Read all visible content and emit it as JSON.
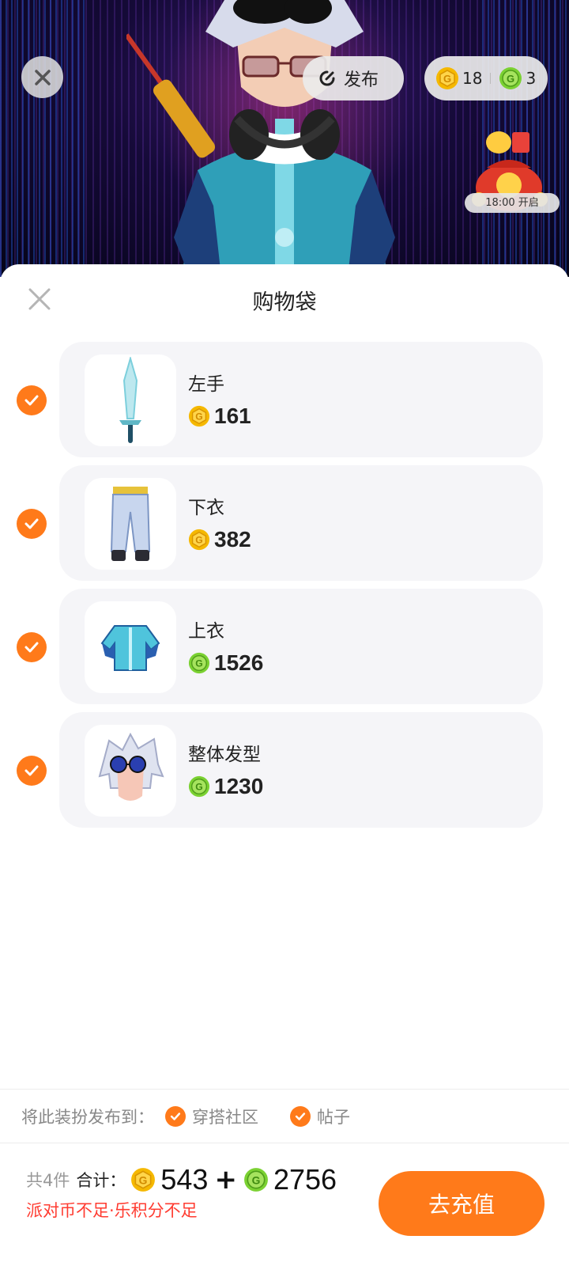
{
  "header": {
    "publish_label": "发布",
    "coins": {
      "gold": "18",
      "green": "3"
    },
    "gift_time": "18:00 开启"
  },
  "sheet": {
    "title": "购物袋",
    "items": [
      {
        "name": "左手",
        "currency": "gold",
        "price": "161",
        "icon": "sword-icon"
      },
      {
        "name": "下衣",
        "currency": "gold",
        "price": "382",
        "icon": "pants-icon"
      },
      {
        "name": "上衣",
        "currency": "green",
        "price": "1526",
        "icon": "jacket-icon"
      },
      {
        "name": "整体发型",
        "currency": "green",
        "price": "1230",
        "icon": "hairstyle-icon"
      }
    ],
    "publish_to": {
      "label": "将此装扮发布到：",
      "options": [
        "穿搭社区",
        "帖子"
      ]
    }
  },
  "footer": {
    "count": "共4件",
    "total_label": "合计：",
    "gold_total": "543",
    "plus": "+",
    "green_total": "2756",
    "warning": "派对币不足·乐积分不足",
    "recharge_label": "去充值"
  },
  "colors": {
    "accent": "#ff7a1a",
    "gold_coin": "#f5b800",
    "green_coin": "#7bd132",
    "warning": "#ff3b30",
    "card_bg": "#f5f5f8"
  }
}
